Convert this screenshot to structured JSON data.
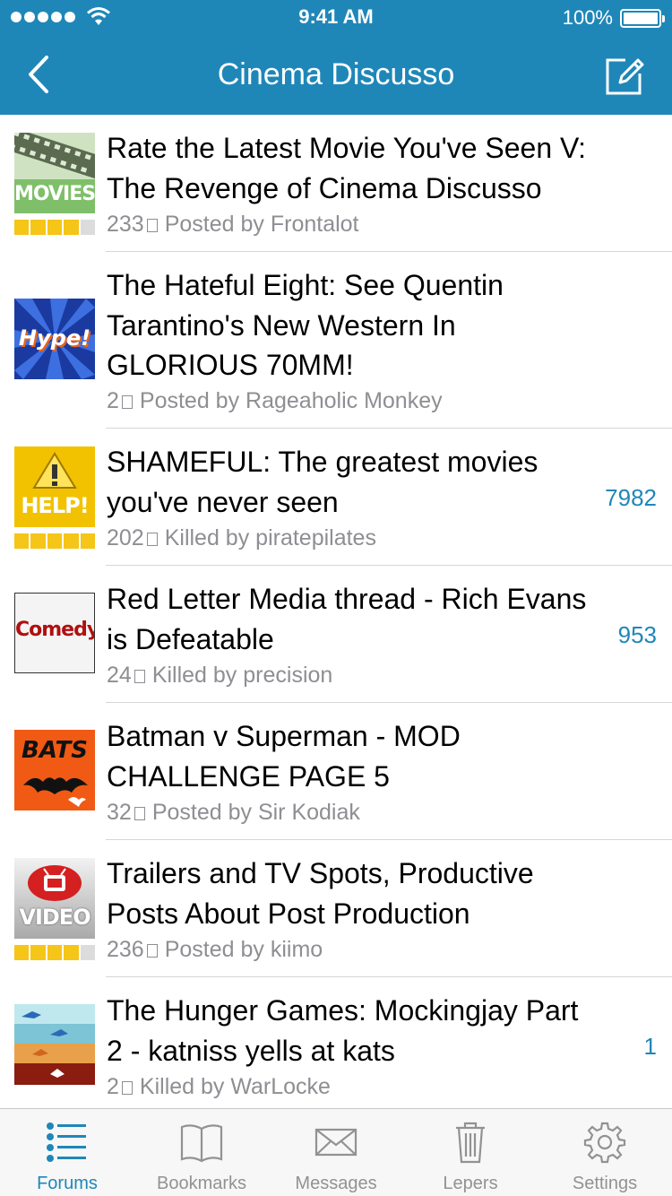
{
  "status_bar": {
    "time": "9:41 AM",
    "battery": "100%"
  },
  "nav": {
    "title": "Cinema Discusso"
  },
  "threads": [
    {
      "title": "Rate the Latest Movie You've Seen V: The Revenge of Cinema Discusso",
      "pages": "233",
      "meta": "Posted by Frontalot",
      "unread": "",
      "icon": "movies-tag-icon",
      "icon_text": "MOVIES",
      "rating": 4
    },
    {
      "title": "The Hateful Eight: See Quentin Tarantino's New Western In GLORIOUS 70MM!",
      "pages": "2",
      "meta": "Posted by Rageaholic Monkey",
      "unread": "",
      "icon": "hype-tag-icon",
      "icon_text": "Hype!",
      "rating": 0
    },
    {
      "title": "SHAMEFUL: The greatest movies you've never seen",
      "pages": "202",
      "meta": "Killed by piratepilates",
      "unread": "7982",
      "icon": "help-tag-icon",
      "icon_text": "HELP!",
      "rating": 5
    },
    {
      "title": "Red Letter Media thread - Rich Evans is Defeatable",
      "pages": "24",
      "meta": "Killed by precision",
      "unread": "953",
      "icon": "comedy-tag-icon",
      "icon_text": "Comedy",
      "rating": 0
    },
    {
      "title": "Batman v Superman - MOD CHALLENGE PAGE 5",
      "pages": "32",
      "meta": "Posted by Sir Kodiak",
      "unread": "",
      "icon": "bats-tag-icon",
      "icon_text": "BATS",
      "rating": 0
    },
    {
      "title": "Trailers and TV Spots, Productive Posts About Post Production",
      "pages": "236",
      "meta": "Posted by kiimo",
      "unread": "",
      "icon": "video-tag-icon",
      "icon_text": "VIDEO",
      "rating": 4
    },
    {
      "title": "The Hunger Games: Mockingjay Part 2 - katniss yells at kats",
      "pages": "2",
      "meta": "Killed by WarLocke",
      "unread": "1",
      "icon": "hunger-games-tag-icon",
      "icon_text": "",
      "rating": 0
    }
  ],
  "tabs": [
    {
      "label": "Forums",
      "icon": "list-icon",
      "active": true
    },
    {
      "label": "Bookmarks",
      "icon": "book-icon",
      "active": false
    },
    {
      "label": "Messages",
      "icon": "envelope-icon",
      "active": false
    },
    {
      "label": "Lepers",
      "icon": "trash-icon",
      "active": false
    },
    {
      "label": "Settings",
      "icon": "gear-icon",
      "active": false
    }
  ],
  "colors": {
    "accent": "#1f87b8",
    "rating_on": "#f5c518",
    "meta_gray": "#8e8e93"
  }
}
